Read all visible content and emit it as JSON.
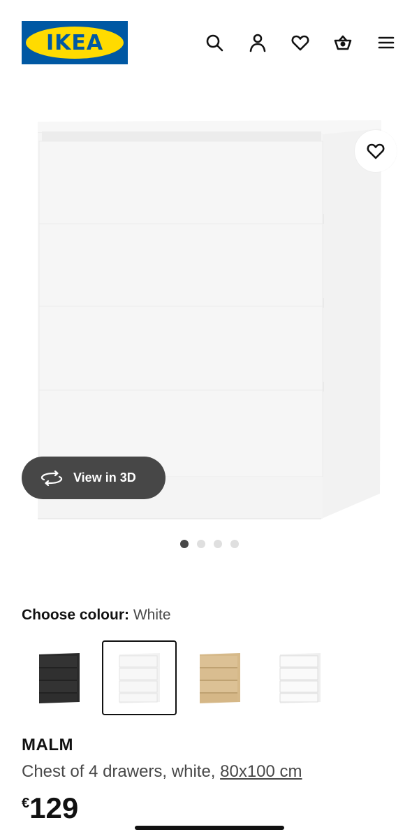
{
  "header": {
    "logo_text": "IKEA",
    "icons": [
      "search-icon",
      "user-icon",
      "heart-icon",
      "basket-icon",
      "menu-icon"
    ]
  },
  "gallery": {
    "view_3d_label": "View in 3D",
    "image_count": 4,
    "active_index": 0
  },
  "colour": {
    "label": "Choose colour:",
    "selected": "White",
    "options": [
      "black-brown",
      "white",
      "white stained oak veneer",
      "high-gloss white"
    ]
  },
  "product": {
    "name": "MALM",
    "description": "Chest of 4 drawers, white,",
    "size": "80x100 cm",
    "currency": "€",
    "price": "129"
  },
  "colors": {
    "ikea_blue": "#0058a3",
    "ikea_yellow": "#ffdb00",
    "pill_bg": "#474747"
  }
}
